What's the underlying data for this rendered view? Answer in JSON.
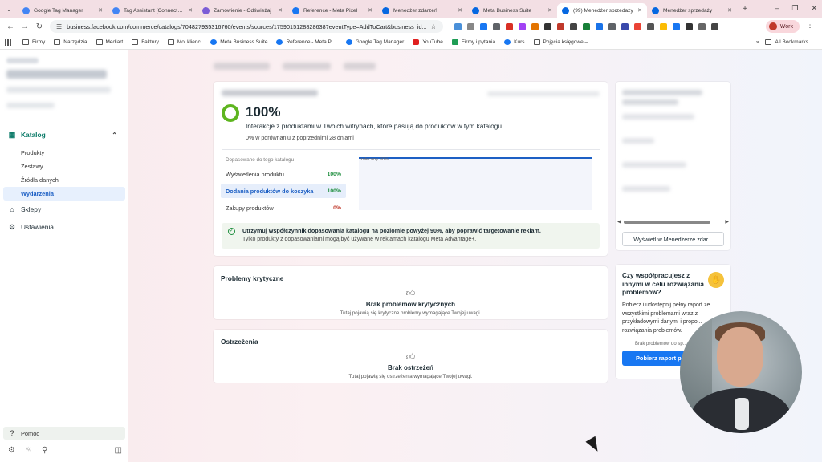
{
  "browser": {
    "tabs": [
      {
        "title": "Google Tag Manager",
        "color": "#4285f4",
        "active": false
      },
      {
        "title": "Tag Assistant [Connected]",
        "color": "#4285f4",
        "active": false
      },
      {
        "title": "Zamówienie - Odświeżaj",
        "color": "#7b5cd6",
        "active": false
      },
      {
        "title": "Reference - Meta Pixel",
        "color": "#1877f2",
        "active": false
      },
      {
        "title": "Menedżer zdarzeń",
        "color": "#0668e1",
        "active": false
      },
      {
        "title": "Meta Business Suite",
        "color": "#0668e1",
        "active": false
      },
      {
        "title": "(99) Menedżer sprzedaży",
        "color": "#0668e1",
        "active": true
      },
      {
        "title": "Menedżer sprzedaży",
        "color": "#0668e1",
        "active": false
      }
    ],
    "url": "business.facebook.com/commerce/catalogs/704827935316760/events/sources/1759015128828638?eventType=AddToCart&business_id...",
    "profile": "Work",
    "bookmarks": [
      "Firmy",
      "Narzędzia",
      "Mediart",
      "Faktury",
      "Moi klienci",
      "Meta Business Suite",
      "Reference - Meta Pi...",
      "Google Tag Manager",
      "YouTube",
      "Firmy i pytania",
      "Kurs",
      "Pojęcia księgowe –..."
    ],
    "all_bookmarks": "All Bookmarks"
  },
  "sidebar": {
    "section": "Katalog",
    "subitems": [
      "Produkty",
      "Zestawy",
      "Źródła danych",
      "Wydarzenia"
    ],
    "active_subitem": "Wydarzenia",
    "items": [
      "Sklepy",
      "Ustawienia"
    ],
    "help": "Pomoc"
  },
  "match": {
    "percent": "100%",
    "description": "Interakcje z produktami w Twoich witrynach, które pasują do produktów w tym katalogu",
    "comparison": "0% w porównaniu z poprzednimi 28 dniami",
    "caption": "Dopasowane do tego katalogu",
    "rows": [
      {
        "label": "Wyświetlenia produktu",
        "value": "100%",
        "status": "ok"
      },
      {
        "label": "Dodania produktów do koszyka",
        "value": "100%",
        "status": "ok",
        "selected": true
      },
      {
        "label": "Zakupy produktów",
        "value": "0%",
        "status": "bad"
      }
    ],
    "chart_label": "zalecany 90%",
    "tip_title": "Utrzymuj współczynnik dopasowania katalogu na poziomie powyżej 90%, aby poprawić targetowanie reklam.",
    "tip_body": "Tylko produkty z dopasowaniami mogą być używane w reklamach katalogu Meta Advantage+."
  },
  "critical": {
    "heading": "Problemy krytyczne",
    "title": "Brak problemów krytycznych",
    "body": "Tutaj pojawią się krytyczne problemy wymagające Twojej uwagi."
  },
  "warnings": {
    "heading": "Ostrzeżenia",
    "title": "Brak ostrzeżeń",
    "body": "Tutaj pojawią się ostrzeżenia wymagające Twojej uwagi."
  },
  "right_panel": {
    "view_button": "Wyświetl w Menedżerze zdar...",
    "promo_question": "Czy współpracujesz z innymi w celu rozwiązania problemów?",
    "promo_body": "Pobierz i udostępnij pełny raport ze wszystkimi problemami wraz z przykładowymi danymi i propo... rozwiązania problemów.",
    "promo_small": "Brak problemów do sp...",
    "promo_button": "Pobierz raport p..."
  }
}
